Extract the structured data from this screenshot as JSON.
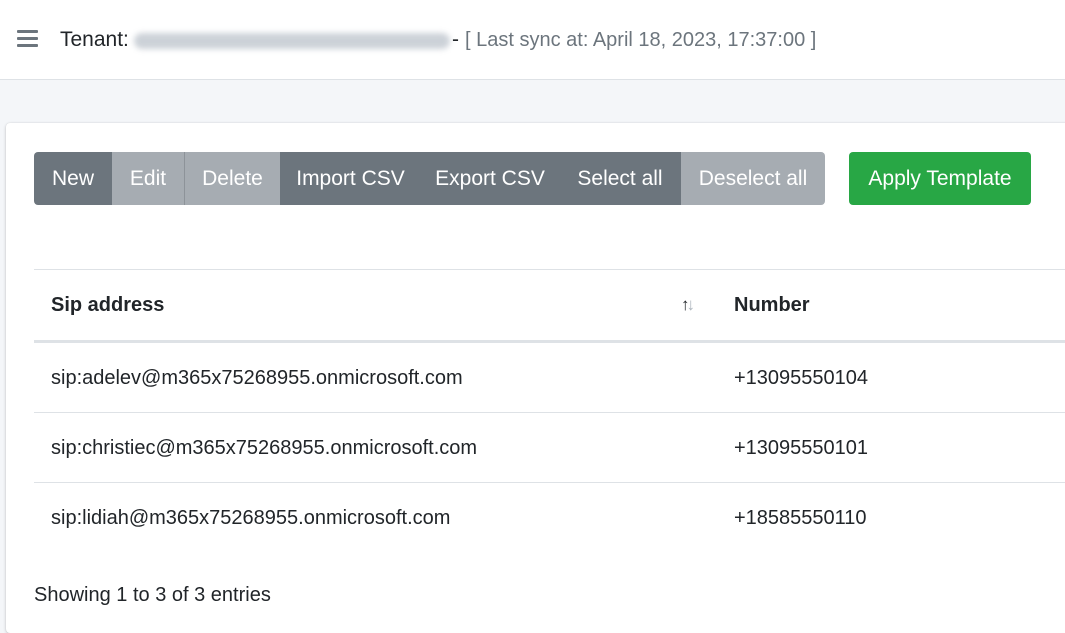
{
  "header": {
    "tenant_label": "Tenant:",
    "dash": "-",
    "sync_text": "[ Last sync at: April 18, 2023, 17:37:00 ]"
  },
  "toolbar": {
    "new_label": "New",
    "edit_label": "Edit",
    "delete_label": "Delete",
    "import_label": "Import CSV",
    "export_label": "Export CSV",
    "select_all_label": "Select all",
    "deselect_all_label": "Deselect all",
    "apply_template_label": "Apply Template"
  },
  "table": {
    "columns": [
      "Sip address",
      "Number"
    ],
    "sort_icon": "sort-arrows-icon",
    "rows": [
      {
        "sip": "sip:adelev@m365x75268955.onmicrosoft.com",
        "number": "+13095550104"
      },
      {
        "sip": "sip:christiec@m365x75268955.onmicrosoft.com",
        "number": "+13095550101"
      },
      {
        "sip": "sip:lidiah@m365x75268955.onmicrosoft.com",
        "number": "+18585550110"
      }
    ]
  },
  "footer": {
    "info": "Showing 1 to 3 of 3 entries"
  },
  "colors": {
    "secondary": "#6c757d",
    "secondary_disabled": "#a6acb2",
    "success": "#28a745"
  }
}
